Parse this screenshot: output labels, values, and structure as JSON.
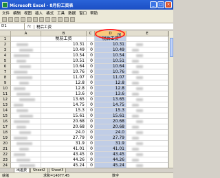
{
  "window": {
    "title": "Microsoft Excel - 8月份工资表",
    "buttons": [
      "_",
      "□",
      "×"
    ]
  },
  "menu": [
    "文件",
    "编辑",
    "视图",
    "插入",
    "格式",
    "工具",
    "数据",
    "窗口",
    "帮助"
  ],
  "formula_bar": {
    "name_box": "D1",
    "fx": "fx",
    "value": "税后工资"
  },
  "columns": [
    "A",
    "B",
    "C",
    "D",
    "E"
  ],
  "header_row": {
    "b": "税前工资",
    "c": "",
    "d": "税后工资"
  },
  "dropdown_arrow": "▾",
  "rows": [
    {
      "n": "1"
    },
    {
      "n": "2",
      "b": "10.31",
      "c": "0",
      "d": "10.31"
    },
    {
      "n": "3",
      "b": "10.49",
      "c": "0",
      "d": "10.49"
    },
    {
      "n": "4",
      "b": "10.54",
      "c": "0",
      "d": "10.54"
    },
    {
      "n": "5",
      "b": "10.51",
      "c": "0",
      "d": "10.51"
    },
    {
      "n": "6",
      "b": "10.64",
      "c": "0",
      "d": "10.64"
    },
    {
      "n": "7",
      "b": "10.76",
      "c": "0",
      "d": "10.76"
    },
    {
      "n": "8",
      "b": "11.07",
      "c": "0",
      "d": "11.07"
    },
    {
      "n": "9",
      "b": "12.8",
      "c": "0",
      "d": "12.8"
    },
    {
      "n": "10",
      "b": "12.8",
      "c": "0",
      "d": "12.8"
    },
    {
      "n": "11",
      "b": "13.6",
      "c": "0",
      "d": "13.6"
    },
    {
      "n": "12",
      "b": "13.65",
      "c": "0",
      "d": "13.65"
    },
    {
      "n": "13",
      "b": "14.75",
      "c": "0",
      "d": "14.75"
    },
    {
      "n": "14",
      "b": "15.3",
      "c": "0",
      "d": "15.3"
    },
    {
      "n": "15",
      "b": "15.61",
      "c": "0",
      "d": "15.61"
    },
    {
      "n": "16",
      "b": "20.68",
      "c": "0",
      "d": "20.68"
    },
    {
      "n": "17",
      "b": "20.68",
      "c": "0",
      "d": "20.68"
    },
    {
      "n": "18",
      "b": "24.0",
      "c": "0",
      "d": "24.0"
    },
    {
      "n": "19",
      "b": "27.79",
      "c": "0",
      "d": "27.79"
    },
    {
      "n": "20",
      "b": "31.9",
      "c": "0",
      "d": "31.9"
    },
    {
      "n": "21",
      "b": "41.01",
      "c": "0",
      "d": "41.01"
    },
    {
      "n": "22",
      "b": "43.45",
      "c": "0",
      "d": "43.45"
    },
    {
      "n": "23",
      "b": "44.26",
      "c": "0",
      "d": "44.26"
    },
    {
      "n": "24",
      "b": "45.24",
      "c": "0",
      "d": "45.24"
    }
  ],
  "sheets": [
    "出差费",
    "Sheet2",
    "Sheet3"
  ],
  "status": {
    "ready": "就绪",
    "sum": "求和=14077.45",
    "mode": "数字"
  },
  "colors": {
    "title_bar": "#1b4fc4",
    "selected_column": "#c0cde6",
    "highlight_circle": "#ff2020"
  }
}
